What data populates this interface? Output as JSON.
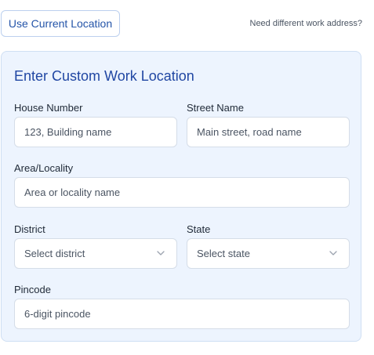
{
  "top": {
    "use_location_label": "Use Current Location",
    "different_address_text": "Need different work address?"
  },
  "panel": {
    "title": "Enter Custom Work Location",
    "house_number": {
      "label": "House Number",
      "placeholder": "123, Building name"
    },
    "street_name": {
      "label": "Street Name",
      "placeholder": "Main street, road name"
    },
    "area": {
      "label": "Area/Locality",
      "placeholder": "Area or locality name"
    },
    "district": {
      "label": "District",
      "selected": "Select district"
    },
    "state": {
      "label": "State",
      "selected": "Select state"
    },
    "pincode": {
      "label": "Pincode",
      "placeholder": "6-digit pincode"
    }
  },
  "icons": {
    "dropdown": "chevron-down-icon"
  }
}
